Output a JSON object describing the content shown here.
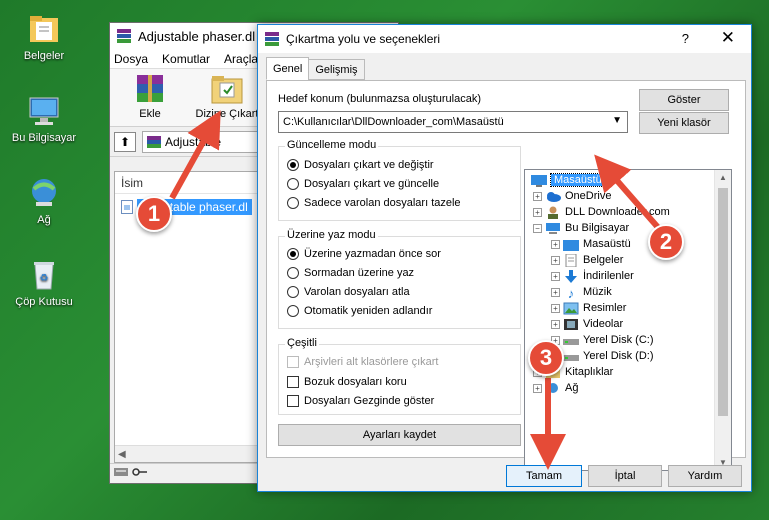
{
  "desktop": {
    "icons": [
      {
        "label": "Belgeler"
      },
      {
        "label": "Bu Bilgisayar"
      },
      {
        "label": "Ağ"
      },
      {
        "label": "Çöp Kutusu"
      }
    ]
  },
  "main_window": {
    "title": "Adjustable phaser.dl",
    "menu": [
      "Dosya",
      "Komutlar",
      "Araçla"
    ],
    "toolbar": {
      "add_label": "Ekle",
      "extract_label": "Dizine Çıkart"
    },
    "address": "Adjustable",
    "column_name": "İsim",
    "file_name": "adjustable phaser.dl"
  },
  "dialog": {
    "title": "Çıkartma yolu ve seçenekleri",
    "help": "?",
    "close": "✕",
    "tabs": [
      "Genel",
      "Gelişmiş"
    ],
    "destination_label": "Hedef konum (bulunmazsa oluşturulacak)",
    "destination_value": "C:\\Kullanıcılar\\DllDownloader_com\\Masaüstü",
    "show_button": "Göster",
    "new_folder_button": "Yeni klasör",
    "update_group": {
      "title": "Güncelleme modu",
      "options": [
        "Dosyaları çıkart ve değiştir",
        "Dosyaları çıkart ve güncelle",
        "Sadece varolan dosyaları tazele"
      ],
      "selected": 0
    },
    "overwrite_group": {
      "title": "Üzerine yaz modu",
      "options": [
        "Üzerine yazmadan önce sor",
        "Sormadan üzerine yaz",
        "Varolan dosyaları atla",
        "Otomatik yeniden adlandır"
      ],
      "selected": 0
    },
    "misc_group": {
      "title": "Çeşitli",
      "options": [
        {
          "label": "Arşivleri alt klasörlere çıkart",
          "disabled": true
        },
        {
          "label": "Bozuk dosyaları koru",
          "disabled": false
        },
        {
          "label": "Dosyaları Gezginde göster",
          "disabled": false
        }
      ]
    },
    "save_settings_button": "Ayarları kaydet",
    "tree": {
      "root": "Masaüstü",
      "items": [
        {
          "label": "OneDrive",
          "icon": "cloud-icon"
        },
        {
          "label": "DLL Downloader.com",
          "icon": "user-icon"
        },
        {
          "label": "Bu Bilgisayar",
          "icon": "computer-icon"
        },
        {
          "label": "Masaüstü",
          "icon": "desktop-folder-icon"
        },
        {
          "label": "Belgeler",
          "icon": "documents-icon"
        },
        {
          "label": "İndirilenler",
          "icon": "download-icon"
        },
        {
          "label": "Müzik",
          "icon": "music-icon"
        },
        {
          "label": "Resimler",
          "icon": "pictures-icon"
        },
        {
          "label": "Videolar",
          "icon": "videos-icon"
        },
        {
          "label": "Yerel Disk (C:)",
          "icon": "drive-icon"
        },
        {
          "label": "Yerel Disk (D:)",
          "icon": "drive-icon"
        },
        {
          "label": "Kitaplıklar",
          "icon": "library-icon"
        },
        {
          "label": "Ağ",
          "icon": "network-icon"
        }
      ]
    },
    "ok_button": "Tamam",
    "cancel_button": "İptal",
    "help_button": "Yardım"
  },
  "annotations": [
    "1",
    "2",
    "3"
  ],
  "colors": {
    "annotation": "#e54b37",
    "selection": "#3399ff",
    "desktop": "#2a8f34"
  }
}
